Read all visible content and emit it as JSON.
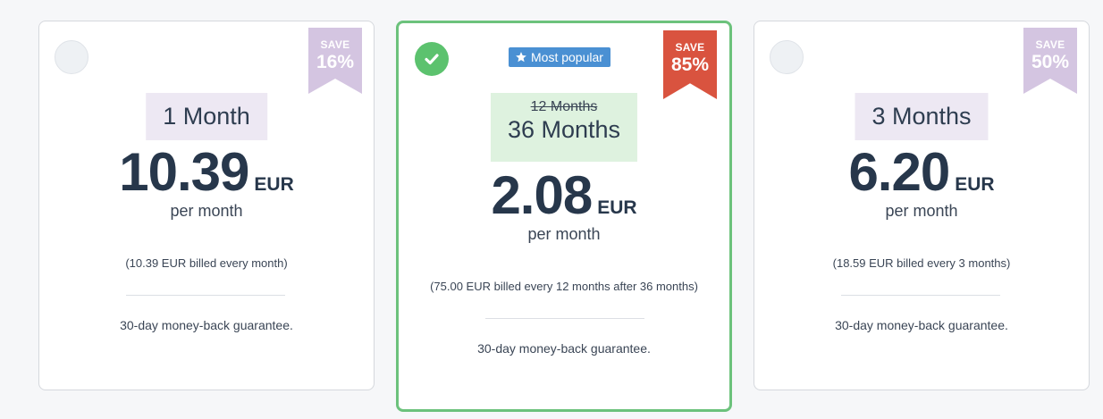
{
  "plans": [
    {
      "term": "1 Month",
      "price": "10.39",
      "currency": "EUR",
      "per": "per month",
      "billed": "(10.39 EUR billed every month)",
      "guarantee": "30-day money-back guarantee.",
      "badge": {
        "save": "SAVE",
        "percent": "16%",
        "color": "#d4c5e1"
      },
      "selected": false
    },
    {
      "old_term": "12 Months",
      "term": "36 Months",
      "price": "2.08",
      "currency": "EUR",
      "per": "per month",
      "billed": "(75.00 EUR billed every 12 months after 36 months)",
      "guarantee": "30-day money-back guarantee.",
      "badge": {
        "save": "SAVE",
        "percent": "85%",
        "color": "#d9533f"
      },
      "popular_label": "Most popular",
      "popular_icon": "star-icon",
      "selected": true
    },
    {
      "term": "3 Months",
      "price": "6.20",
      "currency": "EUR",
      "per": "per month",
      "billed": "(18.59 EUR billed every 3 months)",
      "guarantee": "30-day money-back guarantee.",
      "badge": {
        "save": "SAVE",
        "percent": "50%",
        "color": "#d4c5e1"
      },
      "selected": false
    }
  ],
  "colors": {
    "selected_border": "#6cc27c",
    "check": "#5cc26e",
    "popular_badge": "#4a90d3",
    "text_dark": "#27374b"
  }
}
